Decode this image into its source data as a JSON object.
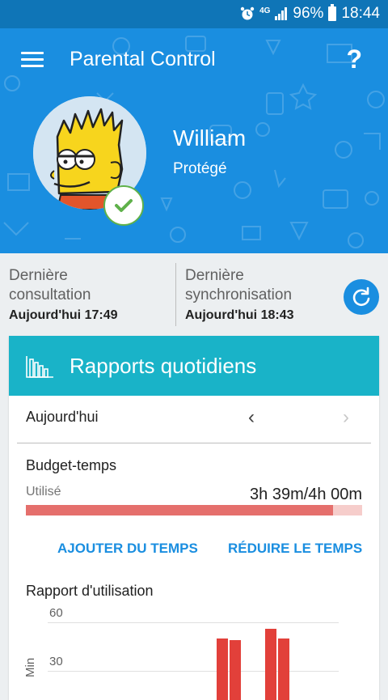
{
  "status_bar": {
    "network": "4G",
    "battery": "96%",
    "time": "18:44"
  },
  "header": {
    "title": "Parental Control",
    "help": "?"
  },
  "profile": {
    "name": "William",
    "status": "Protégé"
  },
  "info": {
    "last_view_label_1": "Dernière",
    "last_view_label_2": "consultation",
    "last_view_value": "Aujourd'hui 17:49",
    "last_sync_label_1": "Dernière",
    "last_sync_label_2": "synchronisation",
    "last_sync_value": "Aujourd'hui 18:43"
  },
  "report": {
    "title": "Rapports quotidiens",
    "day": "Aujourd'hui",
    "budget_title": "Budget-temps",
    "used_label": "Utilisé",
    "used_value": "3h 39m/4h 00m",
    "used_fraction": 0.9125,
    "add_time": "AJOUTER DU TEMPS",
    "reduce_time": "RÉDUIRE LE TEMPS",
    "usage_title": "Rapport d'utilisation"
  },
  "chart_data": {
    "type": "bar",
    "ylabel": "Min",
    "yticks": [
      60,
      30
    ],
    "visible_range": [
      25,
      60
    ],
    "values": [
      50,
      49,
      56,
      50
    ],
    "color": "#e2403a"
  },
  "colors": {
    "primary": "#1a8ee0",
    "teal": "#19b3c8",
    "bar_used": "#e56f6c",
    "bar_track": "#f6cdcb",
    "success": "#5fb14a"
  }
}
